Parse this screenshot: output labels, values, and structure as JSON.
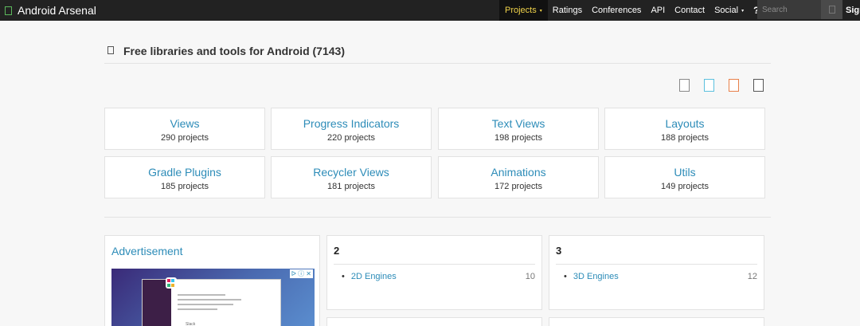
{
  "nav": {
    "brand": "Android Arsenal",
    "items": [
      {
        "label": "Projects",
        "active": true,
        "caret": "▾"
      },
      {
        "label": "Ratings"
      },
      {
        "label": "Conferences"
      },
      {
        "label": "API"
      },
      {
        "label": "Contact"
      },
      {
        "label": "Social",
        "caret": "▾"
      },
      {
        "label": "?"
      }
    ],
    "search_placeholder": "Search",
    "signin": "Sign"
  },
  "header": {
    "title": "Free libraries and tools for Android (7143)"
  },
  "view_toggles": [
    "default",
    "blue",
    "orange",
    "dark"
  ],
  "categories": [
    {
      "title": "Views",
      "count": "290 projects"
    },
    {
      "title": "Progress Indicators",
      "count": "220 projects"
    },
    {
      "title": "Text Views",
      "count": "198 projects"
    },
    {
      "title": "Layouts",
      "count": "188 projects"
    },
    {
      "title": "Gradle Plugins",
      "count": "185 projects"
    },
    {
      "title": "Recycler Views",
      "count": "181 projects"
    },
    {
      "title": "Animations",
      "count": "172 projects"
    },
    {
      "title": "Utils",
      "count": "149 projects"
    }
  ],
  "panels": {
    "ad": {
      "title": "Advertisement",
      "close": "ᐅ ⓘ ✕",
      "popup": "Slack"
    },
    "group2": {
      "heading": "2",
      "items": [
        {
          "label": "2D Engines",
          "count": "10"
        }
      ]
    },
    "group3": {
      "heading": "3",
      "items": [
        {
          "label": "3D Engines",
          "count": "12"
        }
      ]
    }
  },
  "colors": {
    "link": "#2d8cb8",
    "navbar": "#222222",
    "active_nav": "#f0d34a"
  }
}
